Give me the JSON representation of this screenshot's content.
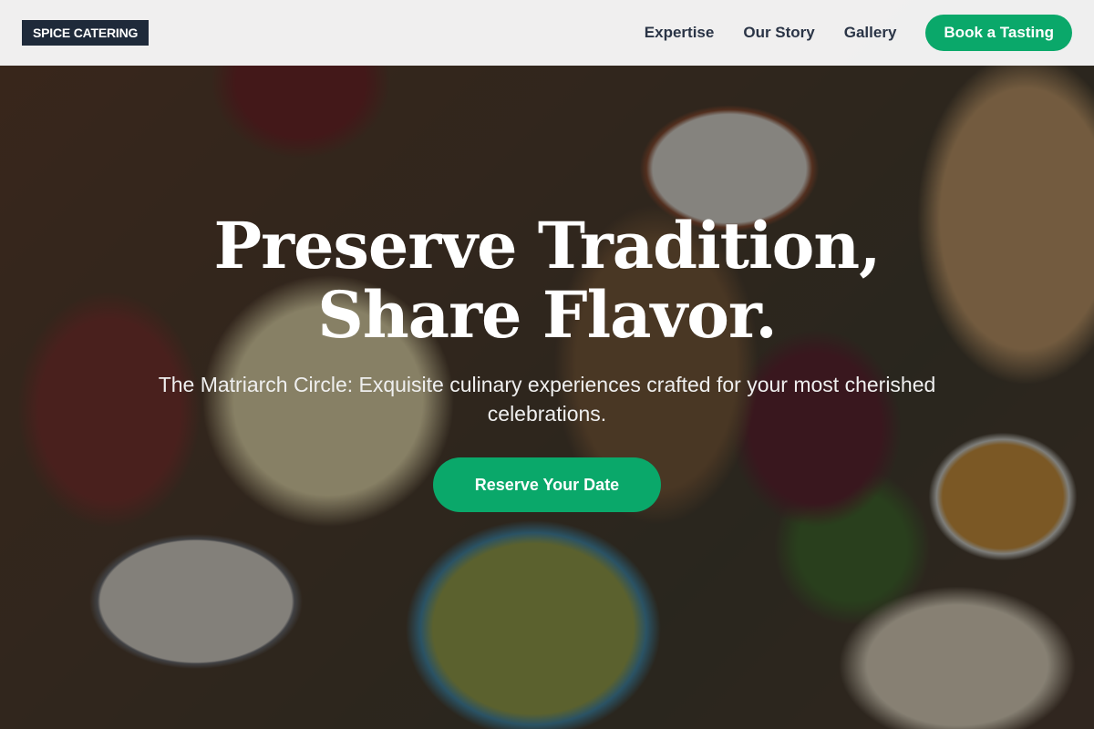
{
  "brand": {
    "logo_text": "SPICE CATERING"
  },
  "nav": {
    "links": [
      {
        "label": "Expertise"
      },
      {
        "label": "Our Story"
      },
      {
        "label": "Gallery"
      }
    ],
    "cta_label": "Book a Tasting"
  },
  "hero": {
    "title": "Preserve Tradition, Share Flavor.",
    "subtitle": "The Matriarch Circle: Exquisite culinary experiences crafted for your most cherished celebrations.",
    "cta_label": "Reserve Your Date"
  },
  "colors": {
    "accent": "#0aa86a",
    "logo_bg": "#1f2a3a",
    "nav_text": "#2a3446"
  }
}
